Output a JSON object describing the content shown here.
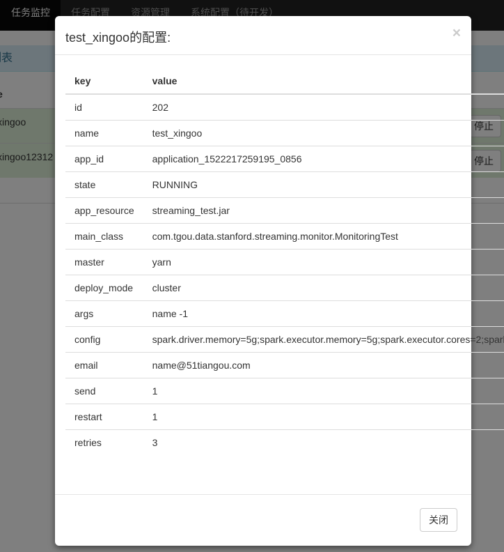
{
  "navbar": {
    "items": [
      {
        "label": "任务监控",
        "active": true
      },
      {
        "label": "任务配置",
        "active": false
      },
      {
        "label": "资源管理",
        "active": false
      },
      {
        "label": "系统配置（待开发）",
        "active": false
      }
    ]
  },
  "background": {
    "panel_title": "列表",
    "column_header": "e",
    "rows": [
      {
        "name": "xingoo",
        "button": "停止"
      },
      {
        "name": "xingoo12312",
        "button": "停止"
      }
    ]
  },
  "modal": {
    "title": "test_xingoo的配置:",
    "close_symbol": "×",
    "table": {
      "headers": {
        "key": "key",
        "value": "value"
      },
      "rows": [
        {
          "key": "id",
          "value": "202"
        },
        {
          "key": "name",
          "value": "test_xingoo"
        },
        {
          "key": "app_id",
          "value": "application_1522217259195_0856"
        },
        {
          "key": "state",
          "value": "RUNNING"
        },
        {
          "key": "app_resource",
          "value": "streaming_test.jar"
        },
        {
          "key": "main_class",
          "value": "com.tgou.data.stanford.streaming.monitor.MonitoringTest"
        },
        {
          "key": "master",
          "value": "yarn"
        },
        {
          "key": "deploy_mode",
          "value": "cluster"
        },
        {
          "key": "args",
          "value": "name -1"
        },
        {
          "key": "config",
          "value": "spark.driver.memory=5g;spark.executor.memory=5g;spark.executor.cores=2;spark"
        },
        {
          "key": "email",
          "value": "name@51tiangou.com"
        },
        {
          "key": "send",
          "value": "1"
        },
        {
          "key": "restart",
          "value": "1"
        },
        {
          "key": "retries",
          "value": "3"
        }
      ]
    },
    "footer_button": "关闭"
  }
}
